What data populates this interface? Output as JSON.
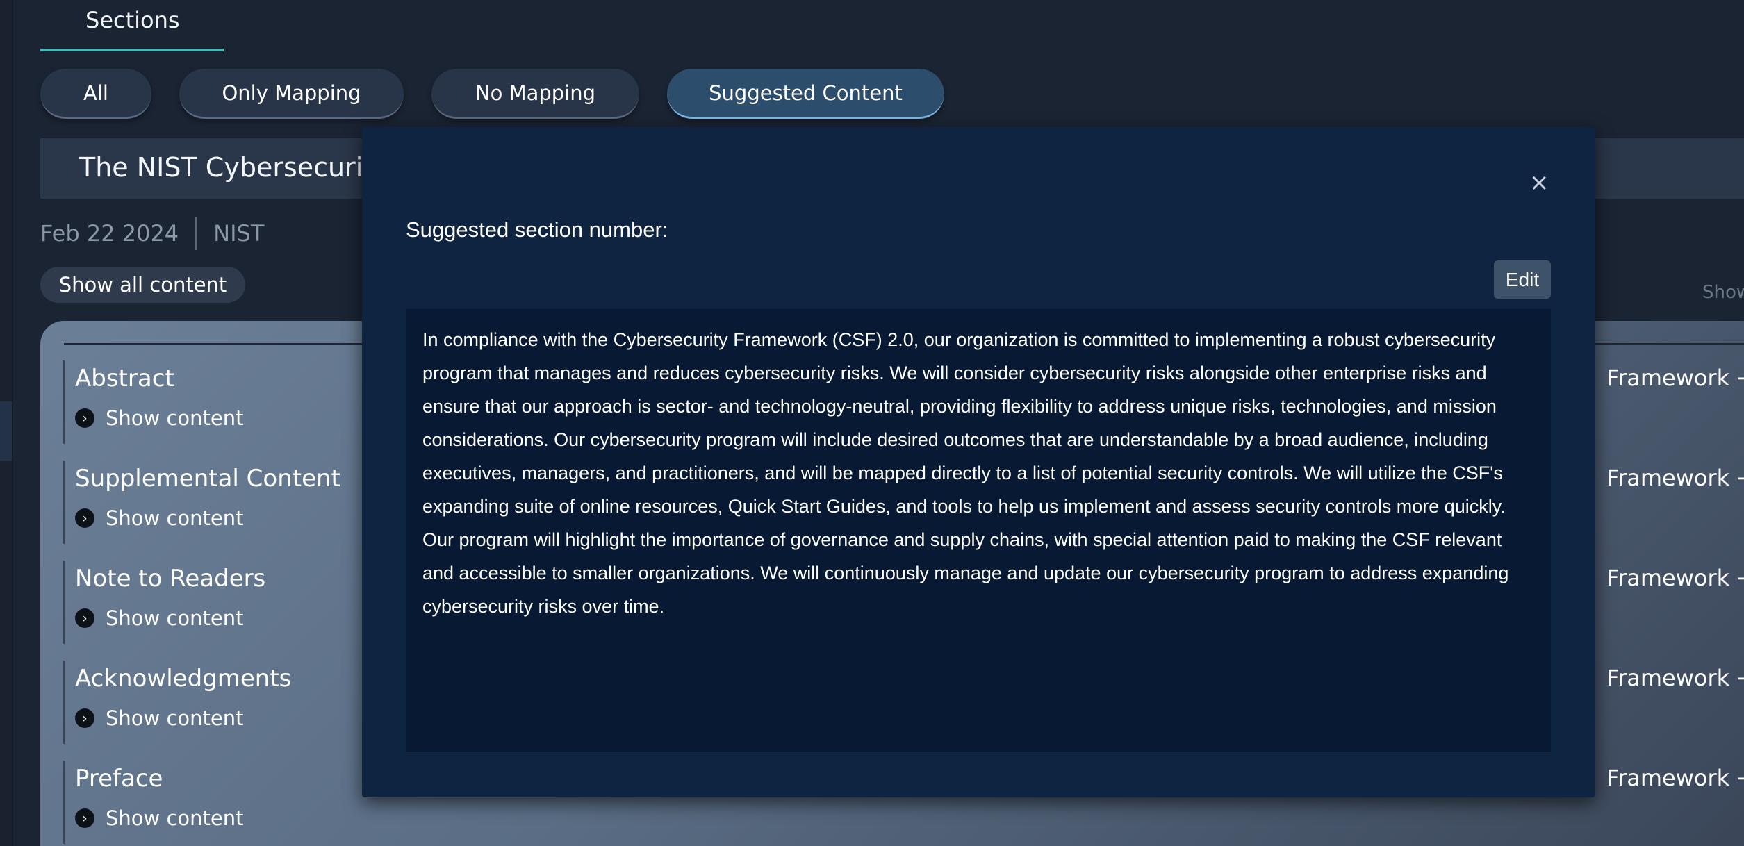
{
  "tabs": {
    "sections_label": "Sections"
  },
  "filters": [
    {
      "label": "All",
      "active": false
    },
    {
      "label": "Only Mapping",
      "active": false
    },
    {
      "label": "No Mapping",
      "active": false
    },
    {
      "label": "Suggested Content",
      "active": true
    }
  ],
  "document": {
    "title": "The NIST Cybersecurity",
    "date": "Feb 22 2024",
    "source": "NIST",
    "show_all_label": "Show all content",
    "show_right_label": "Show"
  },
  "sections": [
    {
      "title": "Abstract",
      "show_label": "Show content",
      "framework_label": "Framework"
    },
    {
      "title": "Supplemental Content",
      "show_label": "Show content",
      "framework_label": "Framework"
    },
    {
      "title": "Note to Readers",
      "show_label": "Show content",
      "framework_label": "Framework"
    },
    {
      "title": "Acknowledgments",
      "show_label": "Show content",
      "framework_label": "Framework"
    },
    {
      "title": "Preface",
      "show_label": "Show content",
      "framework_label": "Framework"
    }
  ],
  "modal": {
    "close_glyph": "×",
    "label": "Suggested section number:",
    "edit_label": "Edit",
    "text": " In compliance with the Cybersecurity Framework (CSF) 2.0, our organization is committed to implementing a robust cybersecurity program that manages and reduces cybersecurity risks. We will consider cybersecurity risks alongside other enterprise risks and ensure that our approach is sector- and technology-neutral, providing flexibility to address unique risks, technologies, and mission considerations. Our cybersecurity program will include desired outcomes that are understandable by a broad audience, including executives, managers, and practitioners, and will be mapped directly to a list of potential security controls. We will utilize the CSF's expanding suite of online resources, Quick Start Guides, and tools to help us implement and assess security controls more quickly. Our program will highlight the importance of governance and supply chains, with special attention paid to making the CSF relevant and accessible to smaller organizations. We will continuously manage and update our cybersecurity program to address expanding cybersecurity risks over time."
  },
  "icons": {
    "chevron": "chevron-right-icon",
    "arrow": "arrow-right-icon",
    "close": "close-icon"
  },
  "colors": {
    "accent_teal": "#4db7b7",
    "modal_bg": "#0f2440",
    "textarea_bg": "#081a33",
    "active_pill": "#2d4d6d"
  }
}
